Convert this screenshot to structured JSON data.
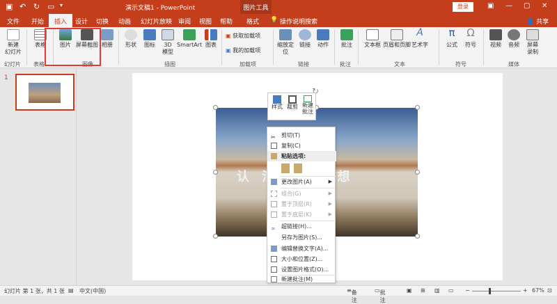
{
  "quick_access": {
    "save_icon": "save-icon",
    "undo_icon": "undo-icon",
    "redo_icon": "redo-icon",
    "start_icon": "start-from-beginning-icon",
    "dropdown_icon": "chevron-down-icon"
  },
  "window": {
    "title": "演示文稿1 - PowerPoint",
    "context_tools": "图片工具",
    "login": "登录"
  },
  "tabs": [
    "文件",
    "开始",
    "插入",
    "设计",
    "切换",
    "动画",
    "幻灯片放映",
    "审阅",
    "视图",
    "帮助",
    "格式"
  ],
  "tell_me": "操作说明搜索",
  "share": "共享",
  "ribbon": {
    "new_slide": "新建\n幻灯片",
    "table": "表格",
    "picture": "图片",
    "screenshot": "屏幕截图",
    "album": "相册",
    "shapes": "形状",
    "icons": "图标",
    "model3d": "3D\n模型",
    "smartart": "SmartArt",
    "chart": "图表",
    "get_addins": "获取加载项",
    "my_addins": "我的加载项",
    "zoom": "缩放定\n位",
    "link": "链接",
    "action": "动作",
    "comment": "批注",
    "textbox": "文本框",
    "header_footer": "页眉和页脚",
    "wordart": "艺术字",
    "equation": "公式",
    "symbol": "符号",
    "video": "视频",
    "audio": "音频",
    "screen_record": "屏幕\n录制",
    "groups": {
      "slides": "幻灯片",
      "tables": "表格",
      "images": "图像",
      "illustrations": "插图",
      "addins": "加载项",
      "links": "链接",
      "comments": "批注",
      "text": "文本",
      "symbols": "符号",
      "media": "媒体"
    }
  },
  "slides_pane": {
    "slide_number": "1"
  },
  "watermark_text": "认 清 放弃幻想",
  "mini_toolbar": {
    "style": "样式",
    "crop": "裁剪",
    "new_comment": "新建\n批注"
  },
  "context_menu": {
    "cut": "剪切(T)",
    "copy": "复制(C)",
    "paste_options": "粘贴选项:",
    "change_picture": "更改图片(A)",
    "group": "组合(G)",
    "bring_front": "置于顶层(R)",
    "send_back": "置于底层(K)",
    "hyperlink": "超链接(H)...",
    "save_as_picture": "另存为图片(S)...",
    "edit_alt_text": "编辑替换文字(A)...",
    "size_position": "大小和位置(Z)...",
    "format_picture": "设置图片格式(O)...",
    "new_comment": "新建批注(M)"
  },
  "status_bar": {
    "slide_info": "幻灯片 第 1 张，共 1 张",
    "language": "中文(中国)",
    "notes": "备注",
    "comments": "批注",
    "zoom": "67%"
  },
  "colors": {
    "accent": "#c43e1c",
    "highlight": "#e53935"
  }
}
